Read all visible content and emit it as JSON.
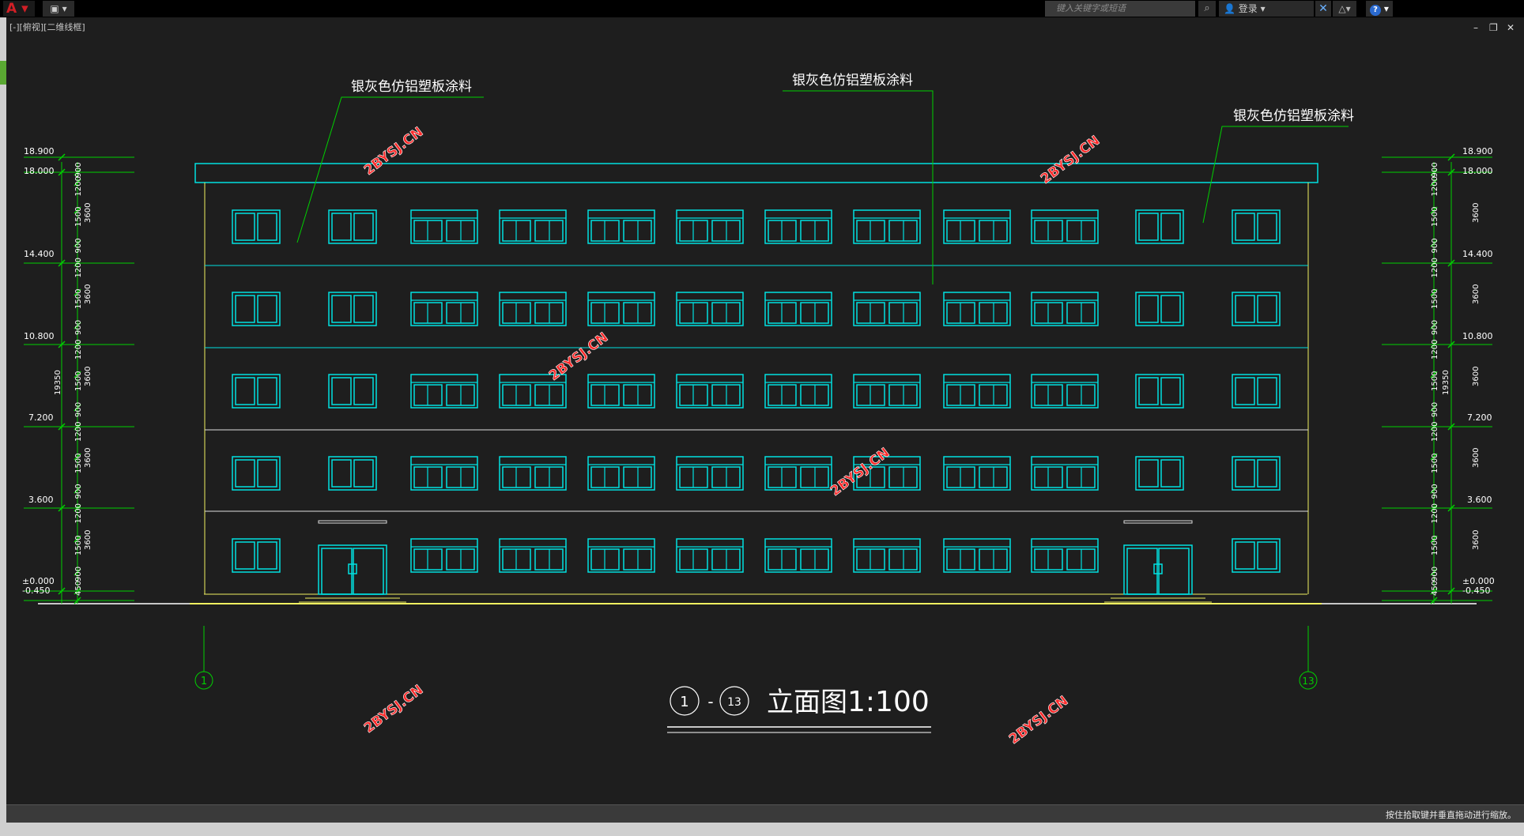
{
  "toolbar": {
    "app_logo": "A",
    "search_placeholder": "键入关键字或短语",
    "login_label": "登录",
    "help_label": "?"
  },
  "viewport": {
    "label": "[-][俯视][二维线框]"
  },
  "drawing": {
    "callouts": [
      "银灰色仿铝塑板涂料",
      "银灰色仿铝塑板涂料",
      "银灰色仿铝塑板涂料"
    ],
    "levels_left": [
      "18.900",
      "18.000",
      "14.400",
      "10.800",
      "7.200",
      "3.600",
      "±0.000",
      "-0.450"
    ],
    "levels_right": [
      "18.900",
      "18.000",
      "14.400",
      "10.800",
      "7.200",
      "3.600",
      "±0.000",
      "-0.450"
    ],
    "dims_inner": [
      "900",
      "1200",
      "1500",
      "900",
      "1200",
      "1500",
      "900",
      "1200",
      "1500",
      "900",
      "1200",
      "1500",
      "900",
      "1200",
      "1500",
      "900",
      "450"
    ],
    "dims_story": [
      "3600",
      "3600",
      "3600",
      "3600",
      "3600"
    ],
    "dim_total": "19350",
    "axis_left": "1",
    "axis_right": "13",
    "title_axes_from": "1",
    "title_axes_to": "13",
    "title_dash": "-",
    "title_text": "立面图",
    "title_scale": "1:100",
    "watermark": "2BYSJ.CN"
  },
  "status": {
    "message": "按住拾取键并垂直拖动进行缩放。"
  },
  "colors": {
    "background": "#1e1e1e",
    "cyan": "#00e0e0",
    "green": "#00d000",
    "yellow": "#f0f060",
    "watermark": "#ff2a2a"
  }
}
